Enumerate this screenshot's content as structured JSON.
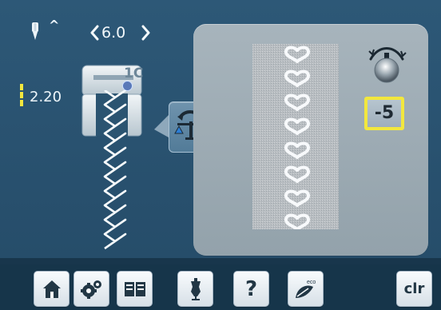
{
  "header": {
    "stitch_width": "6.0",
    "stitch_length": "2.20"
  },
  "presser_foot": {
    "label": "1C"
  },
  "balance_panel": {
    "correction_value": "-5"
  },
  "toolbar": {
    "clr_label": "clr"
  },
  "icons": {
    "needle": "needle-icon",
    "width_left": "chevron-left-icon",
    "width_right": "chevron-right-icon",
    "stitch_length": "stitch-length-icon",
    "balance": "balance-icon",
    "knob": "knob-icon",
    "home": "home-icon",
    "settings": "settings-icon",
    "tutorial": "book-icon",
    "fashion": "dress-form-icon",
    "help": "help-icon",
    "eco": "eco-icon"
  },
  "colors": {
    "background": "#2e5671",
    "panel": "#a7b4bc",
    "highlight": "#f2e73e",
    "toolbar": "#16354a"
  }
}
